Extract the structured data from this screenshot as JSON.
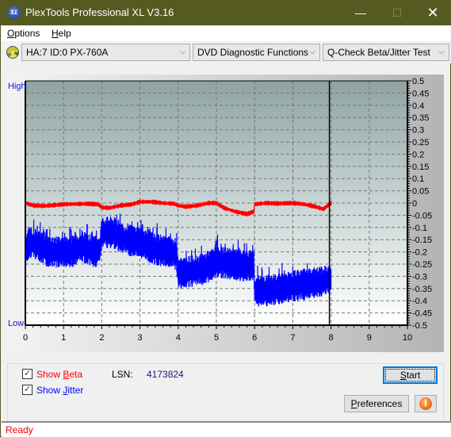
{
  "window": {
    "title": "PlexTools Professional XL V3.16",
    "app_icon_text": "XL",
    "minimize_glyph": "—",
    "maximize_glyph": "☐",
    "close_glyph": "✕"
  },
  "menu": {
    "items": [
      {
        "label": "Options",
        "mnemonic": "O",
        "rest": "ptions"
      },
      {
        "label": "Help",
        "mnemonic": "H",
        "rest": "elp"
      }
    ]
  },
  "toolbar": {
    "drive_icon": "optical-disc-icon",
    "drive_select": "HA:7 ID:0  PX-760A",
    "function_select": "DVD Diagnostic Functions",
    "test_select": "Q-Check Beta/Jitter Test",
    "chevron": "⌵"
  },
  "chart_data": {
    "type": "line",
    "title": "",
    "xlabel": "",
    "ylabel": "",
    "left_axis_labels": {
      "top": "High",
      "bottom": "Low"
    },
    "x_ticks": [
      "0",
      "1",
      "2",
      "3",
      "4",
      "5",
      "6",
      "7",
      "8",
      "9",
      "10"
    ],
    "xlim": [
      0,
      10
    ],
    "y_ticks": [
      "0.5",
      "0.45",
      "0.4",
      "0.35",
      "0.3",
      "0.25",
      "0.2",
      "0.15",
      "0.1",
      "0.05",
      "0",
      "-0.05",
      "-0.1",
      "-0.15",
      "-0.2",
      "-0.25",
      "-0.3",
      "-0.35",
      "-0.4",
      "-0.45",
      "-0.5"
    ],
    "ylim": [
      -0.5,
      0.5
    ],
    "grid": true,
    "end_marker_x": 8.0,
    "series": [
      {
        "name": "Beta",
        "color": "#ff0000",
        "x": [
          0,
          0.2,
          0.5,
          0.8,
          1.0,
          1.3,
          1.6,
          1.9,
          2.0,
          2.2,
          2.5,
          2.8,
          3.0,
          3.3,
          3.6,
          3.9,
          4.0,
          4.2,
          4.5,
          4.8,
          5.0,
          5.2,
          5.5,
          5.8,
          5.98,
          6.0,
          6.3,
          6.6,
          7.0,
          7.3,
          7.6,
          7.8,
          8.0
        ],
        "values": [
          0.0,
          -0.01,
          -0.012,
          -0.008,
          -0.005,
          -0.004,
          -0.003,
          -0.005,
          -0.018,
          -0.02,
          -0.01,
          -0.005,
          0.005,
          0.005,
          0.0,
          -0.003,
          -0.01,
          -0.015,
          -0.01,
          0.0,
          0.0,
          -0.02,
          -0.035,
          -0.045,
          -0.035,
          -0.005,
          0.0,
          -0.002,
          0.0,
          -0.005,
          -0.015,
          -0.025,
          0.0
        ]
      },
      {
        "name": "Jitter",
        "color": "#0000ff",
        "x": [
          0,
          0.1,
          0.3,
          0.6,
          0.9,
          1.2,
          1.5,
          1.8,
          1.95,
          2.0,
          2.3,
          2.6,
          3.0,
          3.4,
          3.8,
          3.95,
          4.0,
          4.3,
          4.7,
          5.0,
          5.4,
          5.8,
          5.98,
          6.0,
          6.3,
          6.7,
          7.0,
          7.4,
          7.8,
          8.0
        ],
        "values": [
          -0.2,
          -0.16,
          -0.17,
          -0.2,
          -0.2,
          -0.2,
          -0.18,
          -0.2,
          -0.19,
          -0.12,
          -0.12,
          -0.15,
          -0.16,
          -0.19,
          -0.2,
          -0.21,
          -0.29,
          -0.28,
          -0.27,
          -0.24,
          -0.25,
          -0.26,
          -0.25,
          -0.36,
          -0.36,
          -0.35,
          -0.34,
          -0.33,
          -0.32,
          -0.31
        ]
      }
    ]
  },
  "controls": {
    "show_beta": {
      "label_pre": "Show ",
      "mnemonic": "B",
      "label_post": "eta",
      "checked": true,
      "check_glyph": "✓",
      "color": "#ff0000"
    },
    "show_jitter": {
      "label_pre": "Show ",
      "mnemonic": "J",
      "label_post": "itter",
      "checked": true,
      "check_glyph": "✓",
      "color": "#0000ff"
    },
    "lsn_label": "LSN:",
    "lsn_value": "4173824",
    "start_pre": "",
    "start_mnemonic": "S",
    "start_post": "tart",
    "preferences_pre": "",
    "preferences_mnemonic": "P",
    "preferences_post": "references",
    "info_glyph": "i"
  },
  "status": {
    "text": "Ready"
  }
}
